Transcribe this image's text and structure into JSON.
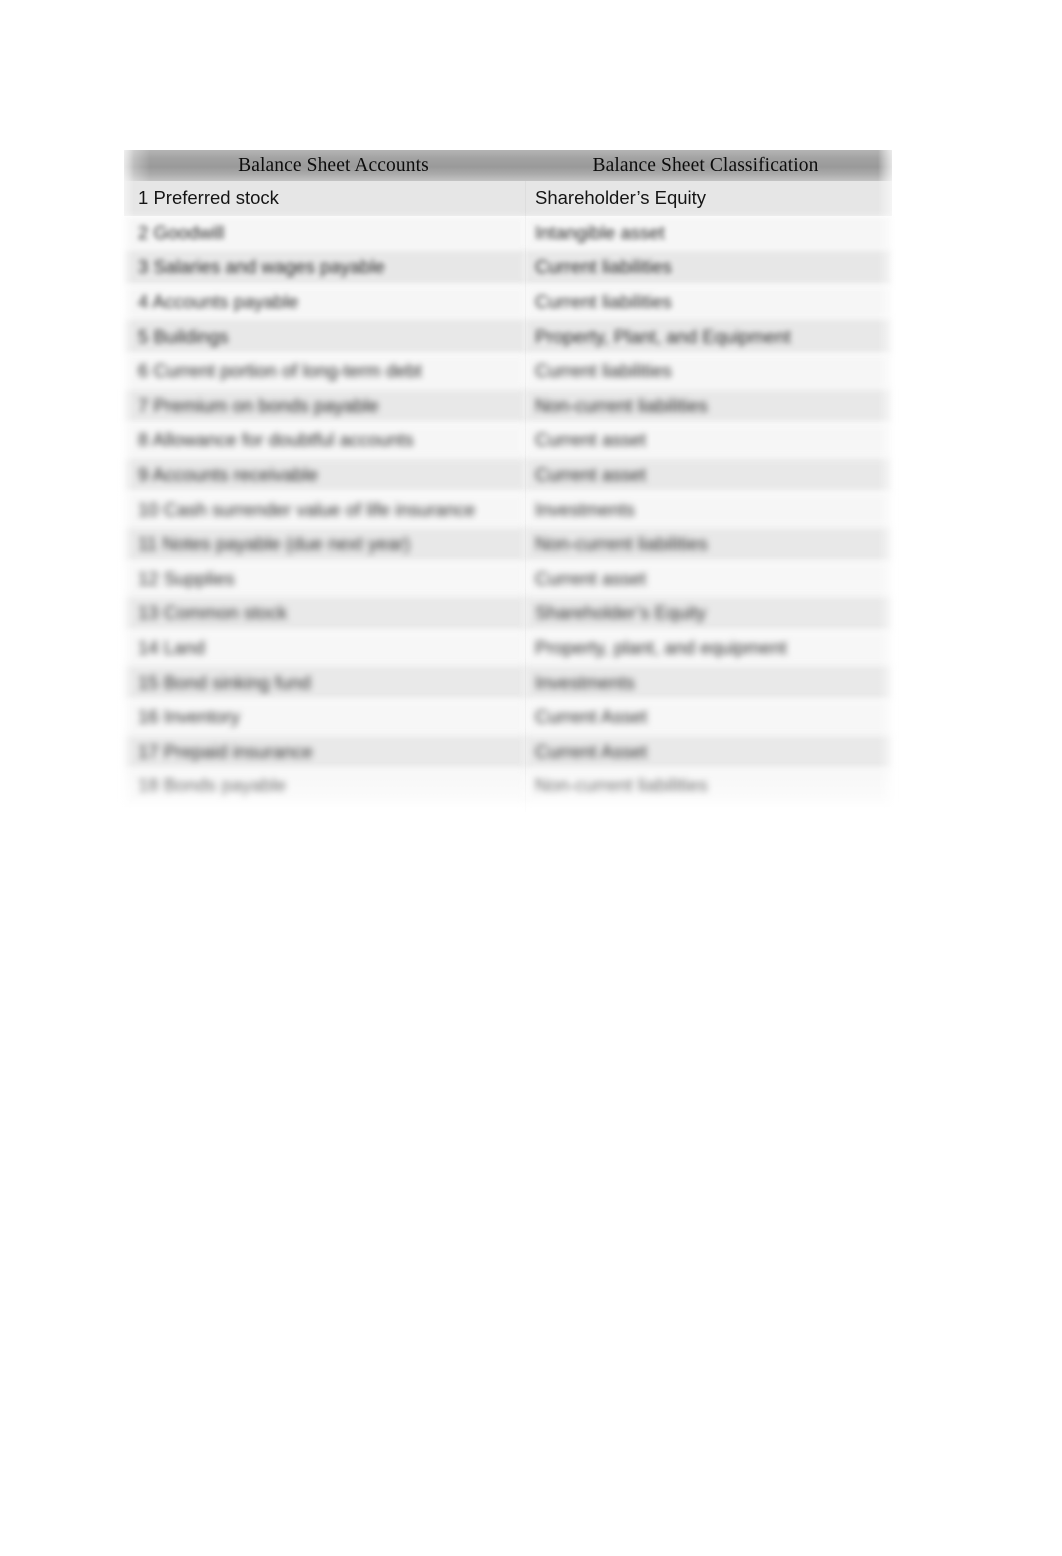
{
  "document": {
    "background_color": "#ffffff",
    "header_band_color": "#9a9a9a",
    "stripe_dark_color": "#e6e6e6",
    "stripe_light_color": "#f6f6f6",
    "text_color": "#151515"
  },
  "table": {
    "headers": {
      "accounts": "Balance Sheet Accounts",
      "classification": "Balance Sheet Classification"
    },
    "rows": [
      {
        "num": "1",
        "account": "Preferred stock",
        "classification": "Shareholder’s Equity",
        "blur": 0
      },
      {
        "num": "2",
        "account": "Goodwill",
        "classification": "Intangible asset",
        "blur": 1
      },
      {
        "num": "3",
        "account": "Salaries and wages payable",
        "classification": "Current liabilities",
        "blur": 1
      },
      {
        "num": "4",
        "account": "Accounts payable",
        "classification": "Current liabilities",
        "blur": 2
      },
      {
        "num": "5",
        "account": "Buildings",
        "classification": "Property, Plant, and Equipment",
        "blur": 2
      },
      {
        "num": "6",
        "account": "Current portion of long-term debt",
        "classification": "Current liabilities",
        "blur": 3
      },
      {
        "num": "7",
        "account": "Premium on bonds payable",
        "classification": "Non-current liabilities",
        "blur": 3
      },
      {
        "num": "8",
        "account": "Allowance for doubtful accounts",
        "classification": "Current asset",
        "blur": 4
      },
      {
        "num": "9",
        "account": "Accounts receivable",
        "classification": "Current asset",
        "blur": 4
      },
      {
        "num": "10",
        "account": "Cash surrender value of life insurance",
        "classification": "Investments",
        "blur": 5
      },
      {
        "num": "11",
        "account": "Notes payable (due next year)",
        "classification": "Non-current liabilities",
        "blur": 5
      },
      {
        "num": "12",
        "account": "Supplies",
        "classification": "Current asset",
        "blur": 6
      },
      {
        "num": "13",
        "account": "Common stock",
        "classification": "Shareholder’s Equity",
        "blur": 6
      },
      {
        "num": "14",
        "account": "Land",
        "classification": "Property, plant, and equipment",
        "blur": 6
      },
      {
        "num": "15",
        "account": "Bond sinking fund",
        "classification": "Investments",
        "blur": 7
      },
      {
        "num": "16",
        "account": "Inventory",
        "classification": "Current Asset",
        "blur": 7
      },
      {
        "num": "17",
        "account": "Prepaid insurance",
        "classification": "Current Asset",
        "blur": 7
      },
      {
        "num": "18",
        "account": "Bonds payable",
        "classification": "Non-current liabilities",
        "blur": 7
      }
    ]
  }
}
